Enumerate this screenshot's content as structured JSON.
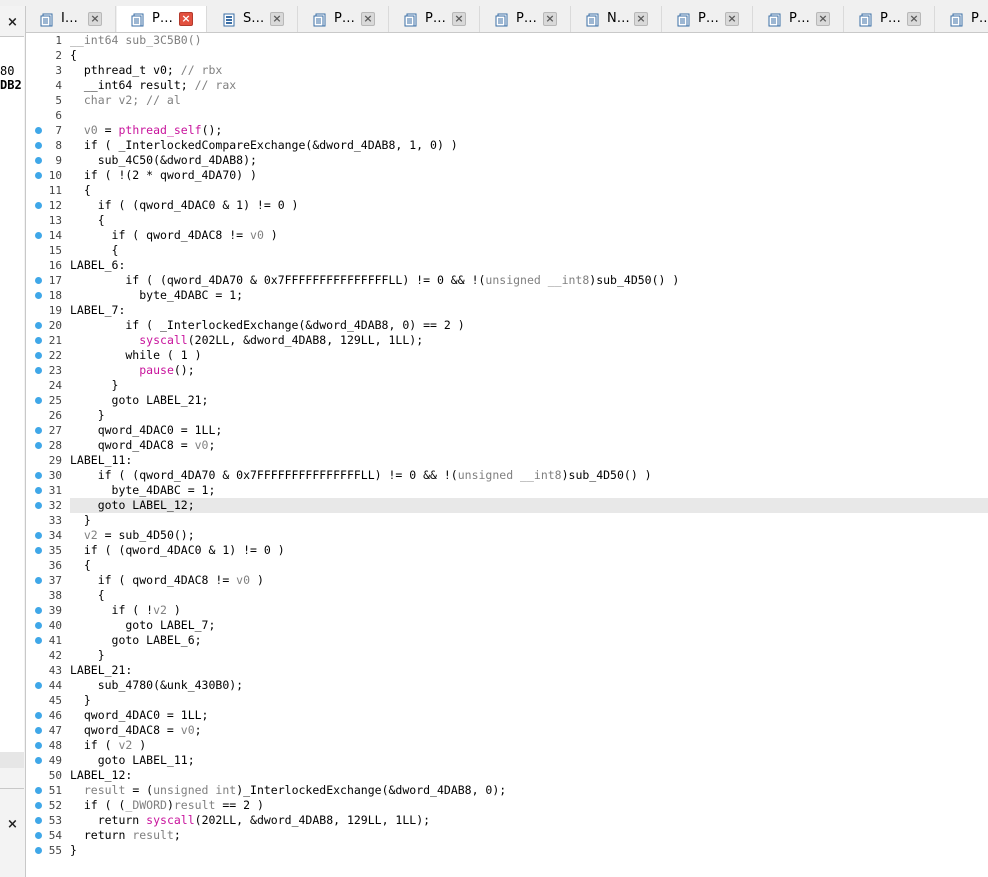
{
  "tabs": [
    {
      "label": "I…",
      "icon": "pseudocode-doc-icon",
      "active": false
    },
    {
      "label": "P…",
      "icon": "pseudocode-doc-icon",
      "active": true
    },
    {
      "label": "S…",
      "icon": "strings-db-icon",
      "active": false
    },
    {
      "label": "P…",
      "icon": "pseudocode-doc-icon",
      "active": false
    },
    {
      "label": "P…",
      "icon": "pseudocode-doc-icon",
      "active": false
    },
    {
      "label": "P…",
      "icon": "pseudocode-doc-icon",
      "active": false
    },
    {
      "label": "N…",
      "icon": "pseudocode-doc-icon",
      "active": false
    },
    {
      "label": "P…",
      "icon": "pseudocode-doc-icon",
      "active": false
    },
    {
      "label": "P…",
      "icon": "pseudocode-doc-icon",
      "active": false
    },
    {
      "label": "P…",
      "icon": "pseudocode-doc-icon",
      "active": false
    },
    {
      "label": "P…",
      "icon": "pseudocode-doc-icon",
      "active": false
    }
  ],
  "left_panel": {
    "close_top": "×",
    "text_a": "80",
    "text_b": "DB2",
    "close_bottom": "×"
  },
  "code": {
    "highlighted_line": 32,
    "lines": [
      {
        "n": "1",
        "bp": false,
        "segs": [
          [
            "t-gray",
            "__int64 sub_3C5B0()"
          ]
        ]
      },
      {
        "n": "2",
        "bp": false,
        "segs": [
          [
            "k",
            "{"
          ]
        ]
      },
      {
        "n": "3",
        "bp": false,
        "segs": [
          [
            "k",
            "  pthread_t v0; "
          ],
          [
            "t-gray",
            "// rbx"
          ]
        ]
      },
      {
        "n": "4",
        "bp": false,
        "segs": [
          [
            "k",
            "  __int64 result; "
          ],
          [
            "t-gray",
            "// rax"
          ]
        ]
      },
      {
        "n": "5",
        "bp": false,
        "segs": [
          [
            "t-gray",
            "  char v2; // al"
          ]
        ]
      },
      {
        "n": "6",
        "bp": false,
        "segs": [
          [
            "k",
            ""
          ]
        ]
      },
      {
        "n": "7",
        "bp": true,
        "segs": [
          [
            "t-gray",
            "  v0"
          ],
          [
            "k",
            " = "
          ],
          [
            "t-fn",
            "pthread_self"
          ],
          [
            "k",
            "();"
          ]
        ]
      },
      {
        "n": "8",
        "bp": true,
        "segs": [
          [
            "k",
            "  if ( _InterlockedCompareExchange(&dword_4DAB8, 1, 0) )"
          ]
        ]
      },
      {
        "n": "9",
        "bp": true,
        "segs": [
          [
            "k",
            "    sub_4C50(&dword_4DAB8);"
          ]
        ]
      },
      {
        "n": "10",
        "bp": true,
        "segs": [
          [
            "k",
            "  if ( !(2 * qword_4DA70) )"
          ]
        ]
      },
      {
        "n": "11",
        "bp": false,
        "segs": [
          [
            "k",
            "  {"
          ]
        ]
      },
      {
        "n": "12",
        "bp": true,
        "segs": [
          [
            "k",
            "    if ( (qword_4DAC0 & 1) != 0 )"
          ]
        ]
      },
      {
        "n": "13",
        "bp": false,
        "segs": [
          [
            "k",
            "    {"
          ]
        ]
      },
      {
        "n": "14",
        "bp": true,
        "segs": [
          [
            "k",
            "      if ( qword_4DAC8 != "
          ],
          [
            "t-gray",
            "v0"
          ],
          [
            "k",
            " )"
          ]
        ]
      },
      {
        "n": "15",
        "bp": false,
        "segs": [
          [
            "k",
            "      {"
          ]
        ]
      },
      {
        "n": "16",
        "bp": false,
        "segs": [
          [
            "k",
            "LABEL_6:"
          ]
        ]
      },
      {
        "n": "17",
        "bp": true,
        "segs": [
          [
            "k",
            "        if ( (qword_4DA70 & 0x7FFFFFFFFFFFFFFFLL) != 0 && !("
          ],
          [
            "t-gray",
            "unsigned __int8"
          ],
          [
            "k",
            ")sub_4D50() )"
          ]
        ]
      },
      {
        "n": "18",
        "bp": true,
        "segs": [
          [
            "k",
            "          byte_4DABC = 1;"
          ]
        ]
      },
      {
        "n": "19",
        "bp": false,
        "segs": [
          [
            "k",
            "LABEL_7:"
          ]
        ]
      },
      {
        "n": "20",
        "bp": true,
        "segs": [
          [
            "k",
            "        if ( _InterlockedExchange(&dword_4DAB8, 0) == 2 )"
          ]
        ]
      },
      {
        "n": "21",
        "bp": true,
        "segs": [
          [
            "k",
            "          "
          ],
          [
            "t-fn",
            "syscall"
          ],
          [
            "k",
            "(202LL, &dword_4DAB8, 129LL, 1LL);"
          ]
        ]
      },
      {
        "n": "22",
        "bp": true,
        "segs": [
          [
            "k",
            "        while ( 1 )"
          ]
        ]
      },
      {
        "n": "23",
        "bp": true,
        "segs": [
          [
            "k",
            "          "
          ],
          [
            "t-fn",
            "pause"
          ],
          [
            "k",
            "();"
          ]
        ]
      },
      {
        "n": "24",
        "bp": false,
        "segs": [
          [
            "k",
            "      }"
          ]
        ]
      },
      {
        "n": "25",
        "bp": true,
        "segs": [
          [
            "k",
            "      goto LABEL_21;"
          ]
        ]
      },
      {
        "n": "26",
        "bp": false,
        "segs": [
          [
            "k",
            "    }"
          ]
        ]
      },
      {
        "n": "27",
        "bp": true,
        "segs": [
          [
            "k",
            "    qword_4DAC0 = 1LL;"
          ]
        ]
      },
      {
        "n": "28",
        "bp": true,
        "segs": [
          [
            "k",
            "    qword_4DAC8 = "
          ],
          [
            "t-gray",
            "v0"
          ],
          [
            "k",
            ";"
          ]
        ]
      },
      {
        "n": "29",
        "bp": false,
        "segs": [
          [
            "k",
            "LABEL_11:"
          ]
        ]
      },
      {
        "n": "30",
        "bp": true,
        "segs": [
          [
            "k",
            "    if ( (qword_4DA70 & 0x7FFFFFFFFFFFFFFFLL) != 0 && !("
          ],
          [
            "t-gray",
            "unsigned __int8"
          ],
          [
            "k",
            ")sub_4D50() )"
          ]
        ]
      },
      {
        "n": "31",
        "bp": true,
        "segs": [
          [
            "k",
            "      byte_4DABC = 1;"
          ]
        ]
      },
      {
        "n": "32",
        "bp": true,
        "segs": [
          [
            "k",
            "    goto LABEL_12;"
          ]
        ]
      },
      {
        "n": "33",
        "bp": false,
        "segs": [
          [
            "k",
            "  }"
          ]
        ]
      },
      {
        "n": "34",
        "bp": true,
        "segs": [
          [
            "t-gray",
            "  v2"
          ],
          [
            "k",
            " = sub_4D50();"
          ]
        ]
      },
      {
        "n": "35",
        "bp": true,
        "segs": [
          [
            "k",
            "  if ( (qword_4DAC0 & 1) != 0 )"
          ]
        ]
      },
      {
        "n": "36",
        "bp": false,
        "segs": [
          [
            "k",
            "  {"
          ]
        ]
      },
      {
        "n": "37",
        "bp": true,
        "segs": [
          [
            "k",
            "    if ( qword_4DAC8 != "
          ],
          [
            "t-gray",
            "v0"
          ],
          [
            "k",
            " )"
          ]
        ]
      },
      {
        "n": "38",
        "bp": false,
        "segs": [
          [
            "k",
            "    {"
          ]
        ]
      },
      {
        "n": "39",
        "bp": true,
        "segs": [
          [
            "k",
            "      if ( !"
          ],
          [
            "t-gray",
            "v2"
          ],
          [
            "k",
            " )"
          ]
        ]
      },
      {
        "n": "40",
        "bp": true,
        "segs": [
          [
            "k",
            "        goto LABEL_7;"
          ]
        ]
      },
      {
        "n": "41",
        "bp": true,
        "segs": [
          [
            "k",
            "      goto LABEL_6;"
          ]
        ]
      },
      {
        "n": "42",
        "bp": false,
        "segs": [
          [
            "k",
            "    }"
          ]
        ]
      },
      {
        "n": "43",
        "bp": false,
        "segs": [
          [
            "k",
            "LABEL_21:"
          ]
        ]
      },
      {
        "n": "44",
        "bp": true,
        "segs": [
          [
            "k",
            "    sub_4780(&unk_430B0);"
          ]
        ]
      },
      {
        "n": "45",
        "bp": false,
        "segs": [
          [
            "k",
            "  }"
          ]
        ]
      },
      {
        "n": "46",
        "bp": true,
        "segs": [
          [
            "k",
            "  qword_4DAC0 = 1LL;"
          ]
        ]
      },
      {
        "n": "47",
        "bp": true,
        "segs": [
          [
            "k",
            "  qword_4DAC8 = "
          ],
          [
            "t-gray",
            "v0"
          ],
          [
            "k",
            ";"
          ]
        ]
      },
      {
        "n": "48",
        "bp": true,
        "segs": [
          [
            "k",
            "  if ( "
          ],
          [
            "t-gray",
            "v2"
          ],
          [
            "k",
            " )"
          ]
        ]
      },
      {
        "n": "49",
        "bp": true,
        "segs": [
          [
            "k",
            "    goto LABEL_11;"
          ]
        ]
      },
      {
        "n": "50",
        "bp": false,
        "segs": [
          [
            "k",
            "LABEL_12:"
          ]
        ]
      },
      {
        "n": "51",
        "bp": true,
        "segs": [
          [
            "t-gray",
            "  result"
          ],
          [
            "k",
            " = ("
          ],
          [
            "t-gray",
            "unsigned int"
          ],
          [
            "k",
            ")_InterlockedExchange(&dword_4DAB8, 0);"
          ]
        ]
      },
      {
        "n": "52",
        "bp": true,
        "segs": [
          [
            "k",
            "  if ( ("
          ],
          [
            "t-gray",
            "_DWORD"
          ],
          [
            "k",
            ")"
          ],
          [
            "t-gray",
            "result"
          ],
          [
            "k",
            " == 2 )"
          ]
        ]
      },
      {
        "n": "53",
        "bp": true,
        "segs": [
          [
            "k",
            "    return "
          ],
          [
            "t-fn",
            "syscall"
          ],
          [
            "k",
            "(202LL, &dword_4DAB8, 129LL, 1LL);"
          ]
        ]
      },
      {
        "n": "54",
        "bp": true,
        "segs": [
          [
            "k",
            "  return "
          ],
          [
            "t-gray",
            "result"
          ],
          [
            "k",
            ";"
          ]
        ]
      },
      {
        "n": "55",
        "bp": true,
        "segs": [
          [
            "k",
            "}"
          ]
        ]
      }
    ]
  },
  "colors": {
    "breakpoint": "#3fa7e8",
    "function_call": "#c8139c",
    "comment_gray": "#808080",
    "active_tab_close": "#e2503f"
  }
}
